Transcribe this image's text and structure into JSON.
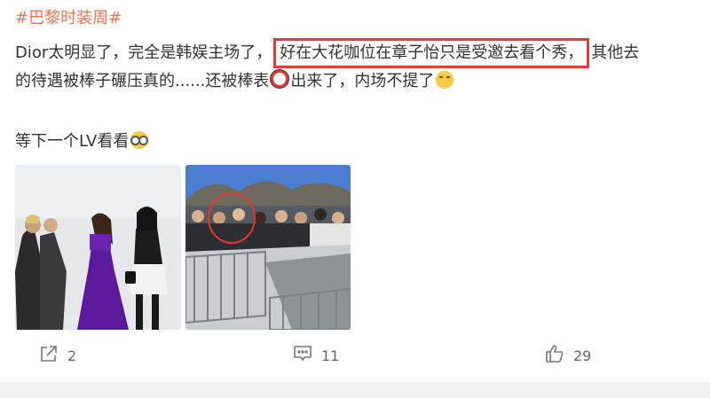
{
  "post": {
    "hashtag": "#巴黎时装周#",
    "line1_prefix": "Dior太明显了，完全是韩娱主场了，",
    "highlight": "好在大花咖位在章子怡只是受邀去看个秀，",
    "line1_suffix": "其他去",
    "line2_text": "的待遇被棒子碾压真的......还被棒表",
    "line2_text2": "出来了，内场不提了",
    "line3_text": "等下一个LV看看",
    "emojis": [
      "unamused-face-icon",
      "glasses-face-icon"
    ]
  },
  "photos": [
    {
      "name": "runway-guests-photo",
      "colors": [
        "#e4e5e8",
        "#5c1a9e",
        "#1d1d1d"
      ]
    },
    {
      "name": "crowd-outside-photo",
      "colors": [
        "#4a79d0",
        "#9aa3ad",
        "#3a3a3a"
      ]
    }
  ],
  "actions": {
    "share_count": "2",
    "comment_count": "11",
    "like_count": "29"
  }
}
